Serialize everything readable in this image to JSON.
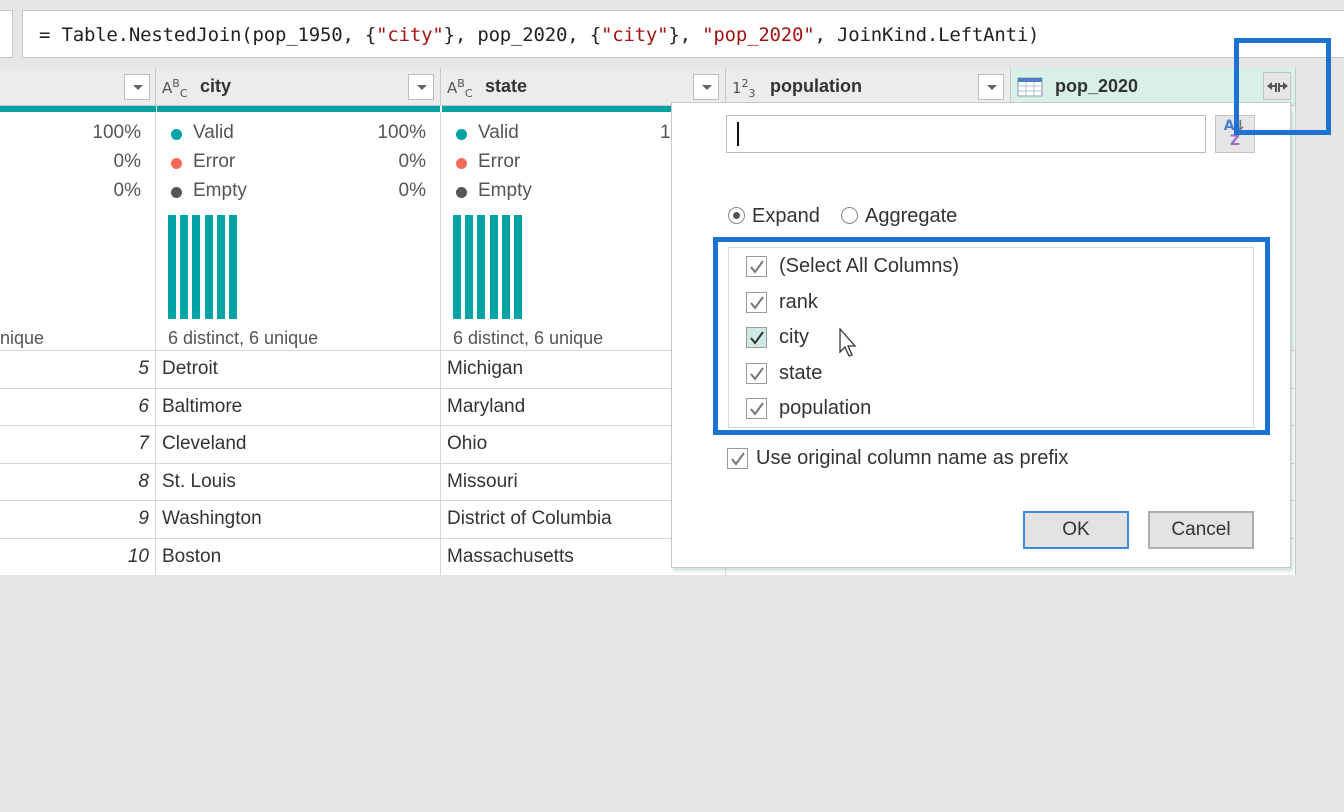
{
  "formula": {
    "prefix": "= Table.NestedJoin(pop_1950, {",
    "s1": "\"city\"",
    "mid1": "}, pop_2020, {",
    "s2": "\"city\"",
    "mid2": "}, ",
    "s3": "\"pop_2020\"",
    "suffix": ", JoinKind.LeftAnti)"
  },
  "columns": [
    {
      "name": "",
      "type_icon": ""
    },
    {
      "name": "city",
      "type_icon": "ABC"
    },
    {
      "name": "state",
      "type_icon": "ABC"
    },
    {
      "name": "population",
      "type_icon": "123"
    },
    {
      "name": "pop_2020",
      "type_icon": "table-icon"
    }
  ],
  "quality": {
    "labels": {
      "valid": "Valid",
      "error": "Error",
      "empty": "Empty"
    },
    "colors": {
      "valid": "#00a3a3",
      "error": "#f26b5b",
      "empty": "#555555"
    },
    "col0": {
      "valid": "100%",
      "error": "0%",
      "empty": "0%",
      "distinct": "nique"
    },
    "city": {
      "valid": "100%",
      "error": "0%",
      "empty": "0%",
      "distinct": "6 distinct, 6 unique"
    },
    "state": {
      "valid_partial": "1",
      "distinct": "6 distinct, 6 unique"
    }
  },
  "rows": [
    {
      "rank": "5",
      "city": "Detroit",
      "state": "Michigan"
    },
    {
      "rank": "6",
      "city": "Baltimore",
      "state": "Maryland"
    },
    {
      "rank": "7",
      "city": "Cleveland",
      "state": "Ohio"
    },
    {
      "rank": "8",
      "city": "St. Louis",
      "state": "Missouri"
    },
    {
      "rank": "9",
      "city": "Washington",
      "state": "District of Columbia"
    },
    {
      "rank": "10",
      "city": "Boston",
      "state": "Massachusetts"
    }
  ],
  "popup": {
    "search_value": "",
    "sort_icon": "A-Z sort",
    "mode_expand": "Expand",
    "mode_aggregate": "Aggregate",
    "selected_mode": "Expand",
    "column_options": [
      {
        "label": "(Select All Columns)",
        "checked": true
      },
      {
        "label": "rank",
        "checked": true
      },
      {
        "label": "city",
        "checked": true
      },
      {
        "label": "state",
        "checked": true
      },
      {
        "label": "population",
        "checked": true
      }
    ],
    "prefix_label": "Use original column name as prefix",
    "prefix_checked": true,
    "ok_label": "OK",
    "cancel_label": "Cancel"
  }
}
